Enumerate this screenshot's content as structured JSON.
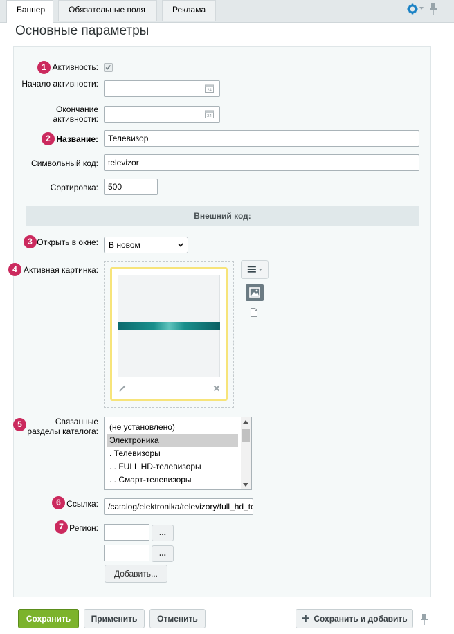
{
  "tabs": [
    {
      "label": "Баннер",
      "active": true
    },
    {
      "label": "Обязательные поля",
      "active": false
    },
    {
      "label": "Реклама",
      "active": false
    }
  ],
  "page_title": "Основные параметры",
  "badges": [
    "1",
    "2",
    "3",
    "4",
    "5",
    "6",
    "7"
  ],
  "form": {
    "active_label": "Активность:",
    "active_checked": true,
    "start_label": "Начало активности:",
    "end_label": "Окончание активности:",
    "start_value": "",
    "end_value": "",
    "name_label": "Название:",
    "name_value": "Телевизор",
    "code_label": "Символьный код:",
    "code_value": "televizor",
    "sort_label": "Сортировка:",
    "sort_value": "500",
    "external_code_header": "Внешний код:",
    "open_label": "Открыть в окне:",
    "open_value": "В новом",
    "image_label": "Активная картинка:",
    "sections_label": "Связанные разделы каталога:",
    "sections_options": [
      "(не установлено)",
      "Электроника",
      ". Телевизоры",
      ". . FULL HD-телевизоры",
      ". . Смарт-телевизоры"
    ],
    "sections_selected": 1,
    "link_label": "Ссылка:",
    "link_value": "/catalog/elektronika/televizory/full_hd_te",
    "region_label": "Регион:",
    "region_values": [
      "",
      ""
    ],
    "dots_label": "...",
    "add_label": "Добавить..."
  },
  "footer": {
    "save": "Сохранить",
    "apply": "Применить",
    "cancel": "Отменить",
    "save_add": "Сохранить и добавить"
  },
  "colors": {
    "badge": "#cb2a5e",
    "save_button": "#7cb32c",
    "image_frame": "#f7e47a"
  },
  "icons": [
    "gear-icon",
    "pin-icon",
    "calendar-icon",
    "menu-icon",
    "image-icon",
    "file-icon",
    "pencil-icon",
    "close-icon",
    "plus-icon"
  ]
}
